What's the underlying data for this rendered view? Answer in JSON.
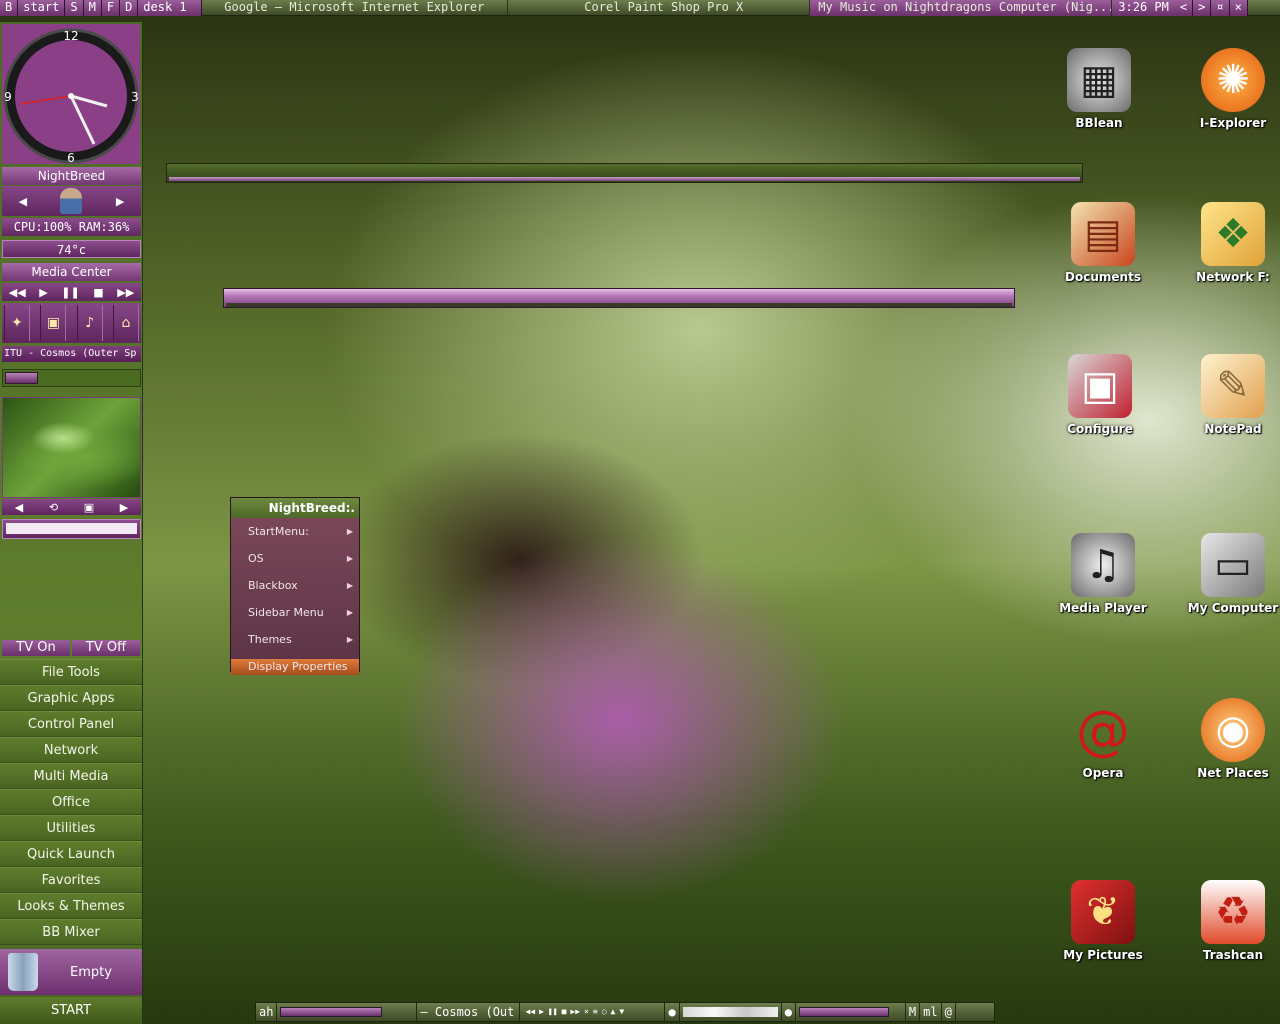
{
  "taskbar": {
    "buttons": [
      "B",
      "start",
      "S",
      "M",
      "F",
      "D",
      "desk 1"
    ],
    "tasks": [
      "Google — Microsoft Internet Explorer",
      "Corel Paint Shop Pro X",
      "My Music on Nightdragons Computer (Nig..."
    ],
    "clock": "3:26 PM",
    "controls": [
      "<",
      ">",
      "¤",
      "×"
    ]
  },
  "sidebar": {
    "clock_numbers": [
      "12",
      "3",
      "6",
      "9"
    ],
    "user_name": "NightBreed",
    "stats": "CPU:100% RAM:36%",
    "temperature": "74°c",
    "media_title": "Media Center",
    "track": "ITU - Cosmos (Outer Sp",
    "tv_on": "TV On",
    "tv_off": "TV Off",
    "menu": [
      "File Tools",
      "Graphic Apps",
      "Control Panel",
      "Network",
      "Multi Media",
      "Office",
      "Utilities",
      "Quick Launch",
      "Favorites",
      "Looks & Themes",
      "BB Mixer"
    ],
    "empty_label": "Empty",
    "start_label": "START"
  },
  "context_menu": {
    "title": "NightBreed:.",
    "items": [
      "StartMenu:",
      "OS",
      "Blackbox",
      "Sidebar Menu",
      "Themes"
    ],
    "highlighted": "Display Properties"
  },
  "desktop_icons": [
    {
      "label": "BBlean",
      "icon": "chip-icon"
    },
    {
      "label": "I-Explorer",
      "icon": "explorer-gear-icon"
    },
    {
      "label": "Documents",
      "icon": "documents-icon"
    },
    {
      "label": "Network F:",
      "icon": "network-folder-icon"
    },
    {
      "label": "Configure",
      "icon": "configure-monitor-icon"
    },
    {
      "label": "NotePad",
      "icon": "notepad-quill-icon"
    },
    {
      "label": "Media Player",
      "icon": "speaker-icon"
    },
    {
      "label": "My Computer",
      "icon": "computer-icon"
    },
    {
      "label": "Opera",
      "icon": "opera-icon"
    },
    {
      "label": "Net Places",
      "icon": "net-places-icon"
    },
    {
      "label": "My Pictures",
      "icon": "pictures-icon"
    },
    {
      "label": "Trashcan",
      "icon": "trashcan-icon"
    }
  ],
  "bottom_bar": {
    "left": "ah",
    "track": "– Cosmos (Out",
    "m_button": "M",
    "ml_button": "ml",
    "at_button": "@"
  },
  "colors": {
    "accent_purple": "#8a3f87",
    "sidebar_green": "#5f7d2d",
    "menu_highlight": "#e07b3a"
  }
}
